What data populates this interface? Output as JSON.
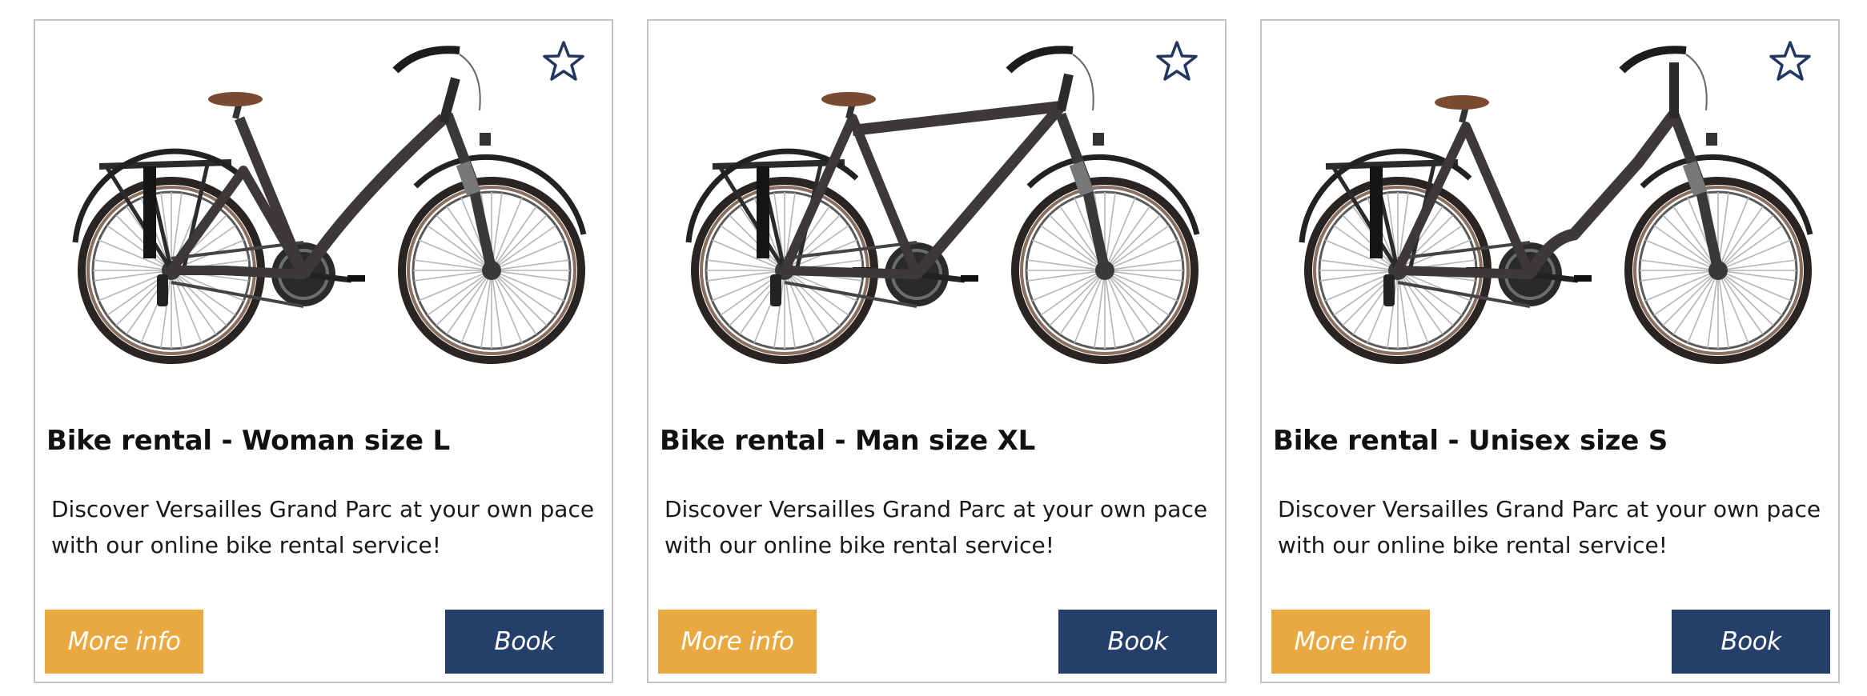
{
  "colors": {
    "more_info_bg": "#e9a940",
    "book_bg": "#253f6b",
    "star_outline": "#22365f",
    "card_border": "#c4c4c4"
  },
  "cards": [
    {
      "title": "Bike rental - Woman size L",
      "description": "Discover Versailles Grand Parc at your own pace with our online bike rental service!",
      "more_info_label": "More info",
      "book_label": "Book",
      "image_icon": "step-through-bicycle-icon",
      "favorite_icon": "star-outline-icon"
    },
    {
      "title": "Bike rental - Man size XL",
      "description": "Discover Versailles Grand Parc at your own pace with our online bike rental service!",
      "more_info_label": "More info",
      "book_label": "Book",
      "image_icon": "diamond-frame-bicycle-icon",
      "favorite_icon": "star-outline-icon"
    },
    {
      "title": "Bike rental - Unisex size S",
      "description": "Discover Versailles Grand Parc at your own pace with our online bike rental service!",
      "more_info_label": "More info",
      "book_label": "Book",
      "image_icon": "low-step-bicycle-icon",
      "favorite_icon": "star-outline-icon"
    }
  ]
}
